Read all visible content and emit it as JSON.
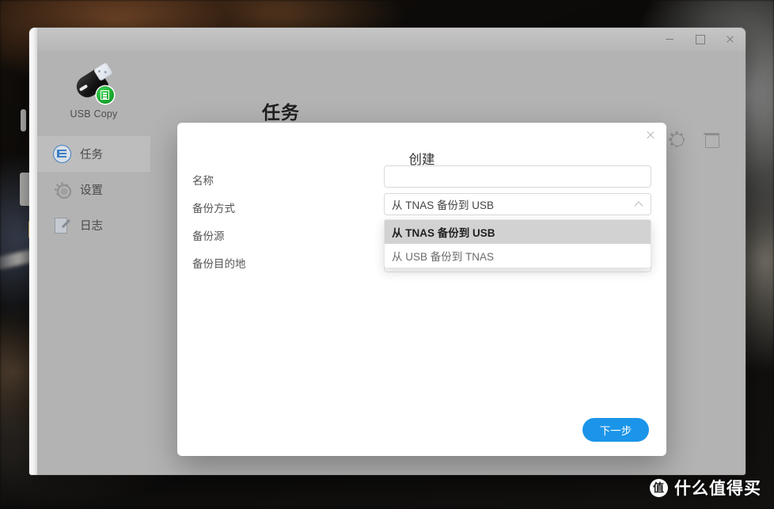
{
  "app": {
    "brand_label": "USB Copy",
    "brand_icon": "usb-drive-icon",
    "page_title": "任务"
  },
  "window_controls": {
    "minimize": "minimize-icon",
    "maximize": "maximize-icon",
    "close": "close-icon"
  },
  "sidebar": {
    "items": [
      {
        "label": "任务",
        "icon": "tasks-icon",
        "active": true
      },
      {
        "label": "设置",
        "icon": "gear-icon",
        "active": false
      },
      {
        "label": "日志",
        "icon": "log-icon",
        "active": false
      }
    ]
  },
  "toolbar": {
    "items": [
      {
        "name": "add",
        "icon": "plus-circle-icon"
      },
      {
        "name": "settings",
        "icon": "gear-icon"
      },
      {
        "name": "delete",
        "icon": "trash-icon"
      }
    ]
  },
  "dialog": {
    "title": "创建",
    "close_icon": "close-icon",
    "fields": [
      {
        "label": "名称",
        "type": "text",
        "value": "",
        "placeholder": ""
      },
      {
        "label": "备份方式",
        "type": "select",
        "value": "从 TNAS 备份到 USB"
      },
      {
        "label": "备份源",
        "type": "hidden"
      },
      {
        "label": "备份目的地",
        "type": "hidden"
      }
    ],
    "dropdown": {
      "open": true,
      "selected_index": 0,
      "options": [
        "从 TNAS 备份到 USB",
        "从 USB 备份到 TNAS"
      ]
    },
    "next_button": "下一步"
  },
  "watermark": {
    "logo_text": "值",
    "text": "什么值得买"
  },
  "colors": {
    "accent_blue": "#1b95e9",
    "window_chrome": "#b3b3b3",
    "dialog_bg": "#ffffff",
    "dropdown_selected_bg": "#d2d2d2",
    "badge_green": "#13a32a"
  }
}
